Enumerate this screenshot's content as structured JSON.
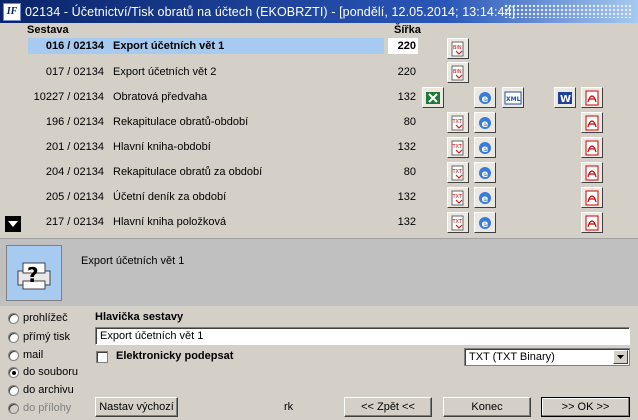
{
  "window": {
    "title": "02134 - Účetnictví/Tisk obratů na účtech (EKOBRZTI) - [pondělí, 12.05.2014; 13:14:44]",
    "app_icon_text": "IF"
  },
  "list": {
    "col_report": "Sestava",
    "col_width": "Šířka",
    "rows": [
      {
        "num": "016 / 02134",
        "name": "Export účetních vět 1",
        "width": "220",
        "selected": true
      },
      {
        "num": "017 / 02134",
        "name": "Export účetních vět 2",
        "width": "220"
      },
      {
        "num": "10227 / 02134",
        "name": "Obratová předvaha",
        "width": "132"
      },
      {
        "num": "196 / 02134",
        "name": "Rekapitulace obratů-období",
        "width": "80"
      },
      {
        "num": "201 / 02134",
        "name": "Hlavní kniha-období",
        "width": "132"
      },
      {
        "num": "204 / 02134",
        "name": "Rekapitulace obratů za období",
        "width": "80"
      },
      {
        "num": "205 / 02134",
        "name": "Účetní deník za období",
        "width": "132"
      },
      {
        "num": "217 / 02134",
        "name": "Hlavní kniha položková",
        "width": "132"
      }
    ],
    "icon_labels": {
      "bin": "BIN",
      "txt": "TXT",
      "xml": "XML",
      "word": "W",
      "excel": "X"
    }
  },
  "description": {
    "text": "Export účetních vět 1"
  },
  "output": {
    "options": [
      {
        "label": "prohlížeč",
        "checked": false,
        "disabled": false
      },
      {
        "label": "přímý tisk",
        "checked": false,
        "disabled": false
      },
      {
        "label": "mail",
        "checked": false,
        "disabled": false
      },
      {
        "label": "do souboru",
        "checked": true,
        "disabled": false
      },
      {
        "label": "do archivu",
        "checked": false,
        "disabled": false
      },
      {
        "label": "do přílohy",
        "checked": false,
        "disabled": true
      }
    ]
  },
  "form": {
    "header_label": "Hlavička sestavy",
    "header_value": "Export účetních vět 1",
    "sign_label": "Elektronicky podepsat",
    "format_value": "TXT (TXT Binary)"
  },
  "buttons": {
    "reset": "Nastav výchozí",
    "rk": "rk",
    "back": "<< Zpět <<",
    "end": "Konec",
    "ok": ">> OK >>"
  }
}
